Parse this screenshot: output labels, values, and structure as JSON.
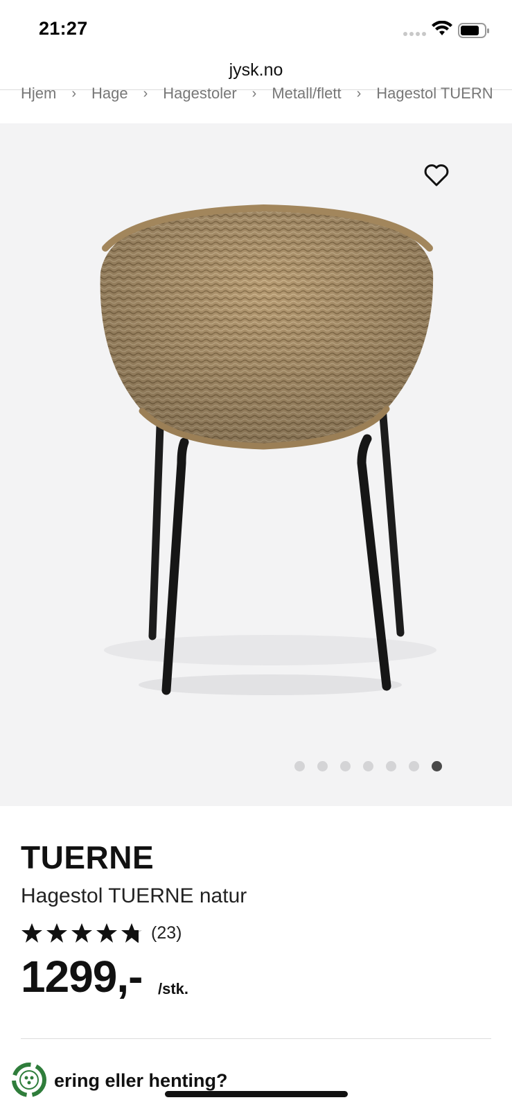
{
  "status_bar": {
    "time": "21:27"
  },
  "browser": {
    "url": "jysk.no"
  },
  "breadcrumb": [
    "Hjem",
    "Hage",
    "Hagestoler",
    "Metall/flett",
    "Hagestol TUERNE"
  ],
  "gallery": {
    "image_count": 7,
    "active_index": 6,
    "favorite_icon": "heart-outline-icon"
  },
  "product": {
    "brand": "TUERNE",
    "name": "Hagestol TUERNE natur",
    "rating": 4.8,
    "reviews": "(23)",
    "price": "1299,-",
    "unit": "/stk."
  },
  "delivery": {
    "question": "ering eller henting?"
  },
  "colors": {
    "star": "#111111",
    "gallery_bg": "#f3f3f4",
    "eco_green": "#2f7d3b"
  }
}
